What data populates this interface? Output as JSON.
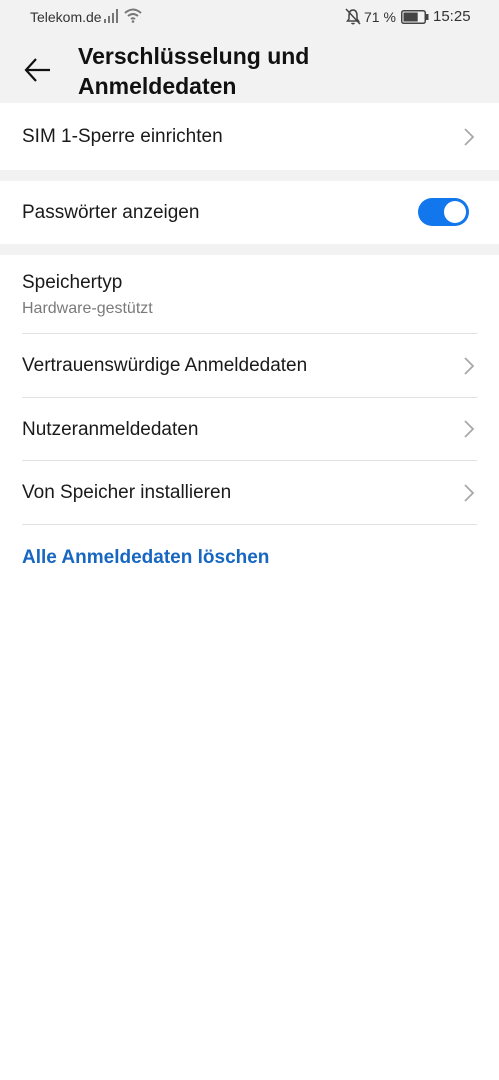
{
  "status_bar": {
    "carrier": "Telekom.de",
    "battery_percent": "71 %",
    "battery_level": 0.71,
    "time": "15:25"
  },
  "header": {
    "title_line1": "Verschlüsselung und",
    "title_line2": "Anmeldedaten"
  },
  "items": {
    "sim_lock": "SIM 1-Sperre einrichten",
    "show_passwords": "Passwörter anzeigen",
    "show_passwords_on": true,
    "storage_type": "Speichertyp",
    "storage_type_value": "Hardware-gestützt",
    "trusted_credentials": "Vertrauenswürdige Anmeldedaten",
    "user_credentials": "Nutzeranmeldedaten",
    "install_from_storage": "Von Speicher installieren",
    "clear_credentials": "Alle Anmeldedaten löschen"
  },
  "colors": {
    "accent": "#1277ec",
    "link": "#1767c1",
    "background_gray": "#f2f2f2"
  }
}
